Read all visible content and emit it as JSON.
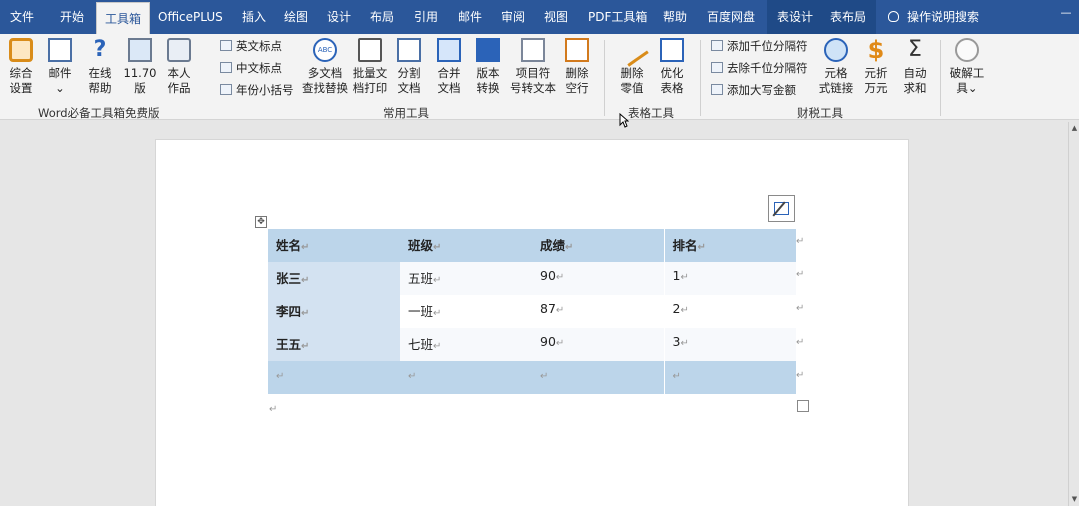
{
  "tabs": [
    {
      "label": "文件"
    },
    {
      "label": "开始"
    },
    {
      "label": "工具箱",
      "active": true
    },
    {
      "label": "OfficePLUS"
    },
    {
      "label": "插入"
    },
    {
      "label": "绘图"
    },
    {
      "label": "设计"
    },
    {
      "label": "布局"
    },
    {
      "label": "引用"
    },
    {
      "label": "邮件"
    },
    {
      "label": "审阅"
    },
    {
      "label": "视图"
    },
    {
      "label": "PDF工具箱"
    },
    {
      "label": "帮助"
    },
    {
      "label": "百度网盘"
    },
    {
      "label": "表设计"
    },
    {
      "label": "表布局"
    }
  ],
  "tell_me": "操作说明搜索",
  "ribbon": {
    "group1": {
      "label": "Word必备工具箱免费版",
      "buttons": [
        {
          "l1": "综合",
          "l2": "设置",
          "icon": "settings-icon"
        },
        {
          "l1": "邮件",
          "l2": "⌄",
          "icon": "mail-icon"
        },
        {
          "l1": "在线",
          "l2": "帮助",
          "icon": "help-icon"
        },
        {
          "l1": "11.70",
          "l2": "版",
          "icon": "version-icon"
        },
        {
          "l1": "本人",
          "l2": "作品",
          "icon": "author-icon"
        }
      ]
    },
    "group2": {
      "label": "常用工具",
      "small": [
        "英文标点",
        "中文标点",
        "年份小括号"
      ],
      "buttons": [
        {
          "l1": "多文档",
          "l2": "查找替换",
          "icon": "abc-icon"
        },
        {
          "l1": "批量文",
          "l2": "档打印",
          "icon": "print-icon"
        },
        {
          "l1": "分割",
          "l2": "文档",
          "icon": "split-icon"
        },
        {
          "l1": "合并",
          "l2": "文档",
          "icon": "merge-icon"
        },
        {
          "l1": "版本",
          "l2": "转换",
          "icon": "convert-icon"
        },
        {
          "l1": "项目符",
          "l2": "号转文本",
          "icon": "bullet-icon"
        },
        {
          "l1": "删除",
          "l2": "空行",
          "icon": "delete-lines-icon"
        }
      ]
    },
    "group3": {
      "label": "表格工具",
      "buttons": [
        {
          "l1": "删除",
          "l2": "零值",
          "icon": "eraser-icon"
        },
        {
          "l1": "优化",
          "l2": "表格",
          "icon": "table-icon"
        }
      ]
    },
    "group4": {
      "label": "财税工具",
      "small": [
        "添加千位分隔符",
        "去除千位分隔符",
        "添加大写金额"
      ],
      "buttons": [
        {
          "l1": "元格",
          "l2": "式链接",
          "icon": "globe-icon"
        },
        {
          "l1": "元折",
          "l2": "万元",
          "icon": "dollar-icon"
        },
        {
          "l1": "自动",
          "l2": "求和",
          "icon": "sigma-icon"
        }
      ]
    },
    "group5": {
      "buttons": [
        {
          "l1": "破解工",
          "l2": "具⌄",
          "icon": "crack-tool-icon"
        }
      ]
    }
  },
  "table": {
    "header": [
      "姓名",
      "班级",
      "成绩",
      "排名"
    ],
    "rows": [
      [
        "张三",
        "五班",
        "90",
        "1"
      ],
      [
        "李四",
        "一班",
        "87",
        "2"
      ],
      [
        "王五",
        "七班",
        "90",
        "3"
      ],
      [
        "",
        "",
        "",
        ""
      ]
    ],
    "mark": "↵"
  },
  "colors": {
    "tabbar": "#2b579a",
    "header_fill": "#bcd5ea",
    "first_col_fill": "#d3e2f1"
  }
}
